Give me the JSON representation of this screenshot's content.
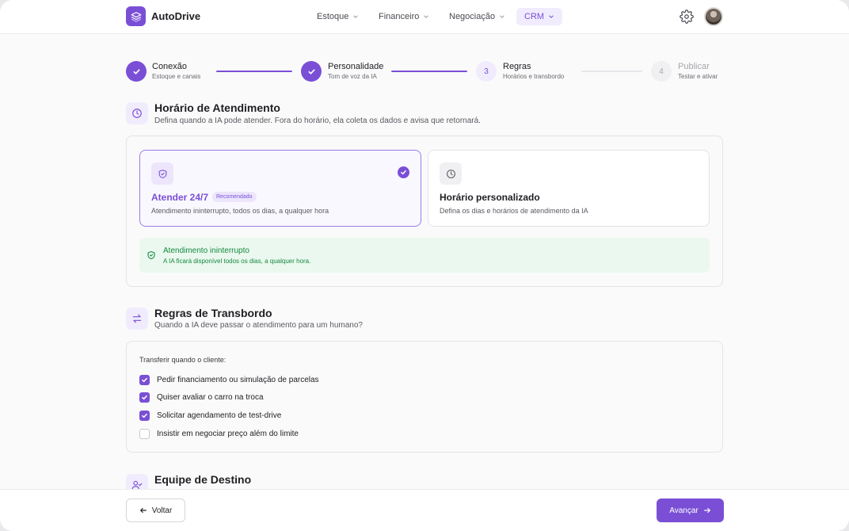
{
  "app": {
    "name": "AutoDrive"
  },
  "nav": [
    {
      "label": "Estoque",
      "active": false
    },
    {
      "label": "Financeiro",
      "active": false
    },
    {
      "label": "Negociação",
      "active": false
    },
    {
      "label": "CRM",
      "active": true
    }
  ],
  "icons": {
    "logo": "layers-icon",
    "settings": "gear-icon",
    "profile": "avatar"
  },
  "stepper": [
    {
      "number": "1",
      "title": "Conexão",
      "subtitle": "Estoque e canais",
      "state": "done"
    },
    {
      "number": "2",
      "title": "Personalidade",
      "subtitle": "Tom de voz da IA",
      "state": "done"
    },
    {
      "number": "3",
      "title": "Regras",
      "subtitle": "Horários e transbordo",
      "state": "current"
    },
    {
      "number": "4",
      "title": "Publicar",
      "subtitle": "Testar e ativar",
      "state": "todo"
    }
  ],
  "schedule": {
    "title": "Horário de Atendimento",
    "subtitle": "Defina quando a IA pode atender. Fora do horário, ela coleta os dados e avisa que retornará.",
    "options": [
      {
        "title": "Atender 24/7",
        "badge": "Recomendado",
        "description": "Atendimento ininterrupto, todos os dias, a qualquer hora",
        "selected": true
      },
      {
        "title": "Horário personalizado",
        "description": "Defina os dias e horários de atendimento da IA",
        "selected": false
      }
    ],
    "alert": {
      "title": "Atendimento ininterrupto",
      "description": "A IA ficará disponível todos os dias, a qualquer hora."
    }
  },
  "handoff": {
    "title": "Regras de Transbordo",
    "subtitle": "Quando a IA deve passar o atendimento para um humano?",
    "label": "Transferir quando o cliente:",
    "rules": [
      {
        "label": "Pedir financiamento ou simulação de parcelas",
        "checked": true
      },
      {
        "label": "Quiser avaliar o carro na troca",
        "checked": true
      },
      {
        "label": "Solicitar agendamento de test-drive",
        "checked": true
      },
      {
        "label": "Insistir em negociar preço além do limite",
        "checked": false
      }
    ]
  },
  "team": {
    "title": "Equipe de Destino"
  },
  "footer": {
    "back": "Voltar",
    "next": "Avançar"
  },
  "colors": {
    "accent": "#7a4fd6",
    "success": "#148a3e",
    "success_bg": "#ebf8ef"
  }
}
